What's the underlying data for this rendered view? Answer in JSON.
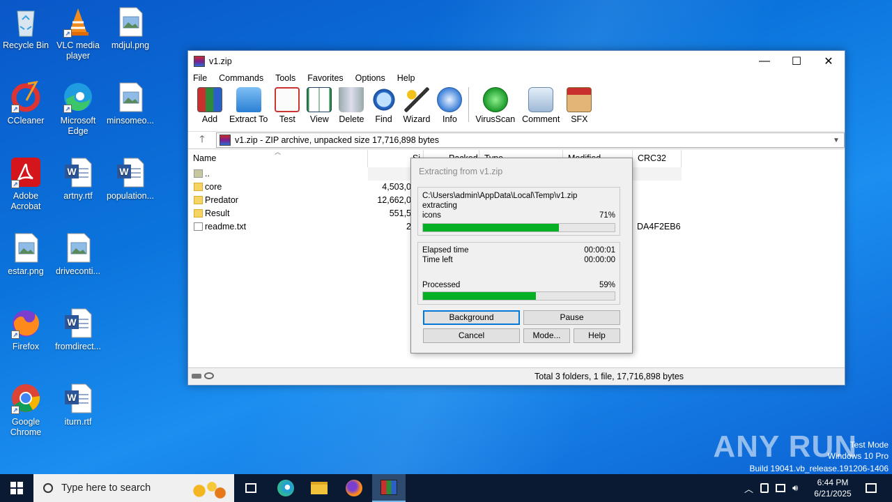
{
  "desktop": {
    "icons": [
      {
        "label": "Recycle Bin",
        "icon": "recycle-bin-icon"
      },
      {
        "label": "VLC media player",
        "icon": "vlc-icon"
      },
      {
        "label": "mdjul.png",
        "icon": "image-file-icon"
      },
      {
        "label": "CCleaner",
        "icon": "ccleaner-icon"
      },
      {
        "label": "Microsoft Edge",
        "icon": "edge-icon"
      },
      {
        "label": "minsomeo...",
        "icon": "image-file-icon"
      },
      {
        "label": "Adobe Acrobat",
        "icon": "acrobat-icon"
      },
      {
        "label": "artny.rtf",
        "icon": "word-doc-icon"
      },
      {
        "label": "population...",
        "icon": "word-doc-icon"
      },
      {
        "label": "estar.png",
        "icon": "image-file-icon"
      },
      {
        "label": "driveconti...",
        "icon": "image-file-icon"
      },
      {
        "label": "Firefox",
        "icon": "firefox-icon"
      },
      {
        "label": "fromdirect...",
        "icon": "word-doc-icon"
      },
      {
        "label": "Google Chrome",
        "icon": "chrome-icon"
      },
      {
        "label": "iturn.rtf",
        "icon": "word-doc-icon"
      }
    ]
  },
  "window": {
    "title": "v1.zip",
    "controls": {
      "minimize": "—",
      "maximize": "☐",
      "close": "✕"
    },
    "menu": [
      "File",
      "Commands",
      "Tools",
      "Favorites",
      "Options",
      "Help"
    ],
    "toolbar": [
      "Add",
      "Extract To",
      "Test",
      "View",
      "Delete",
      "Find",
      "Wizard",
      "Info",
      "VirusScan",
      "Comment",
      "SFX"
    ],
    "address": "v1.zip - ZIP archive, unpacked size 17,716,898 bytes",
    "columns": [
      "Name",
      "Si",
      "Packed",
      "Type",
      "Modified",
      "CRC32"
    ],
    "rows": [
      {
        "name": "..",
        "size": "",
        "crc": ""
      },
      {
        "name": "core",
        "size": "4,503,0",
        "crc": ""
      },
      {
        "name": "Predator",
        "size": "12,662,0",
        "crc": ""
      },
      {
        "name": "Result",
        "size": "551,5",
        "crc": ""
      },
      {
        "name": "readme.txt",
        "size": "2",
        "crc": "DA4F2EB6"
      }
    ],
    "status": "Total 3 folders, 1 file, 17,716,898 bytes"
  },
  "dialog": {
    "title": "Extracting from v1.zip",
    "path": "C:\\Users\\admin\\AppData\\Local\\Temp\\v1.zip",
    "action": "extracting",
    "current_file": "icons",
    "file_percent": "71%",
    "file_progress": 0.71,
    "elapsed_label": "Elapsed time",
    "elapsed": "00:00:01",
    "left_label": "Time left",
    "left": "00:00:00",
    "processed_label": "Processed",
    "processed_percent": "59%",
    "processed_progress": 0.59,
    "buttons": {
      "background": "Background",
      "pause": "Pause",
      "cancel": "Cancel",
      "mode": "Mode...",
      "help": "Help"
    }
  },
  "watermark": {
    "brand": "ANY RUN",
    "line1": "Test Mode",
    "line2": "Windows 10 Pro",
    "line3": "Build 19041.vb_release.191206-1406"
  },
  "taskbar": {
    "search_placeholder": "Type here to search",
    "time": "6:44 PM",
    "date": "6/21/2025"
  }
}
